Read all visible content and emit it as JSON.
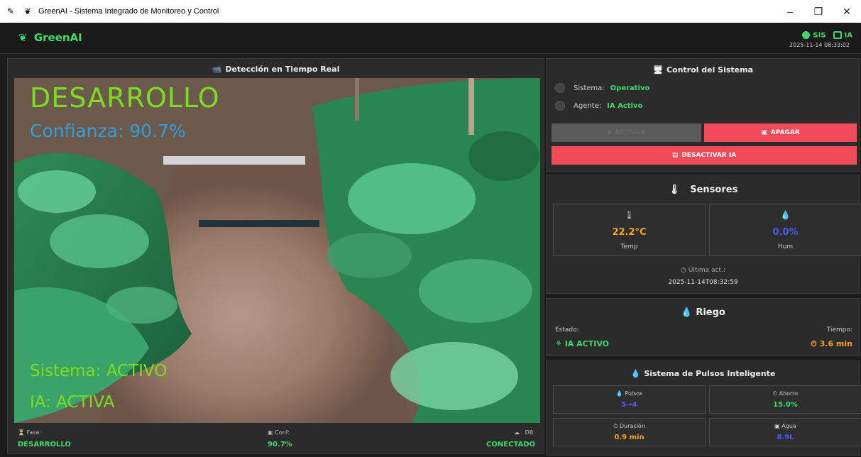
{
  "window": {
    "title": "GreenAI - Sistema Integrado de Monitoreo y Control",
    "title_icon": "quill-icon",
    "controls": {
      "minimize": "–",
      "maximize": "❐",
      "close": "✕"
    }
  },
  "header": {
    "brand": "GreenAI",
    "status": [
      {
        "label": "SIS",
        "icon": "green-dot-icon"
      },
      {
        "label": "IA",
        "icon": "robot-icon"
      }
    ],
    "timestamp": "2025-11-14 08:33:02",
    "accent": "#3ddc6a"
  },
  "detection": {
    "title": "Detección en Tiempo Real",
    "overlay": {
      "phase": "DESARROLLO",
      "confidence": "Confianza: 90.7%",
      "system": "Sistema: ACTIVO",
      "ia": "IA: ACTIVA"
    },
    "footer": {
      "phase_label": "Fase:",
      "phase_value": "DESARROLLO",
      "conf_label": "Conf:",
      "conf_value": "90.7%",
      "db_label": "DB:",
      "db_value": "CONECTADO"
    }
  },
  "control": {
    "title": "Control del Sistema",
    "system_label": "Sistema:",
    "system_value": "Operativo",
    "agent_label": "Agente:",
    "agent_value": "IA Activo",
    "activate_label": "▶ ACTIVAR",
    "shutdown_label": "APAGAR",
    "deactivate_ia_label": "DESACTIVAR IA",
    "button_color": "#f14a58"
  },
  "sensors": {
    "title": "Sensores",
    "temp_value": "22.2°C",
    "temp_label": "Temp",
    "hum_value": "0.0%",
    "hum_label": "Hum",
    "last_update_label": "Última act.:",
    "last_update_value": "2025-11-14T08:32:59",
    "temp_color": "#f5a623",
    "hum_color": "#4a5cf0"
  },
  "irrigation": {
    "title": "Riego",
    "state_label": "Estado:",
    "state_value": "IA ACTIVO",
    "time_label": "Tiempo:",
    "time_value": "3.6 min"
  },
  "pulses": {
    "title": "Sistema de Pulsos Inteligente",
    "pulses_label": "Pulsos",
    "pulses_value": "5→4",
    "saving_label": "Ahorro",
    "saving_value": "15.0%",
    "duration_label": "Duración",
    "duration_value": "0.9 min",
    "water_label": "Agua",
    "water_value": "8.9L"
  }
}
